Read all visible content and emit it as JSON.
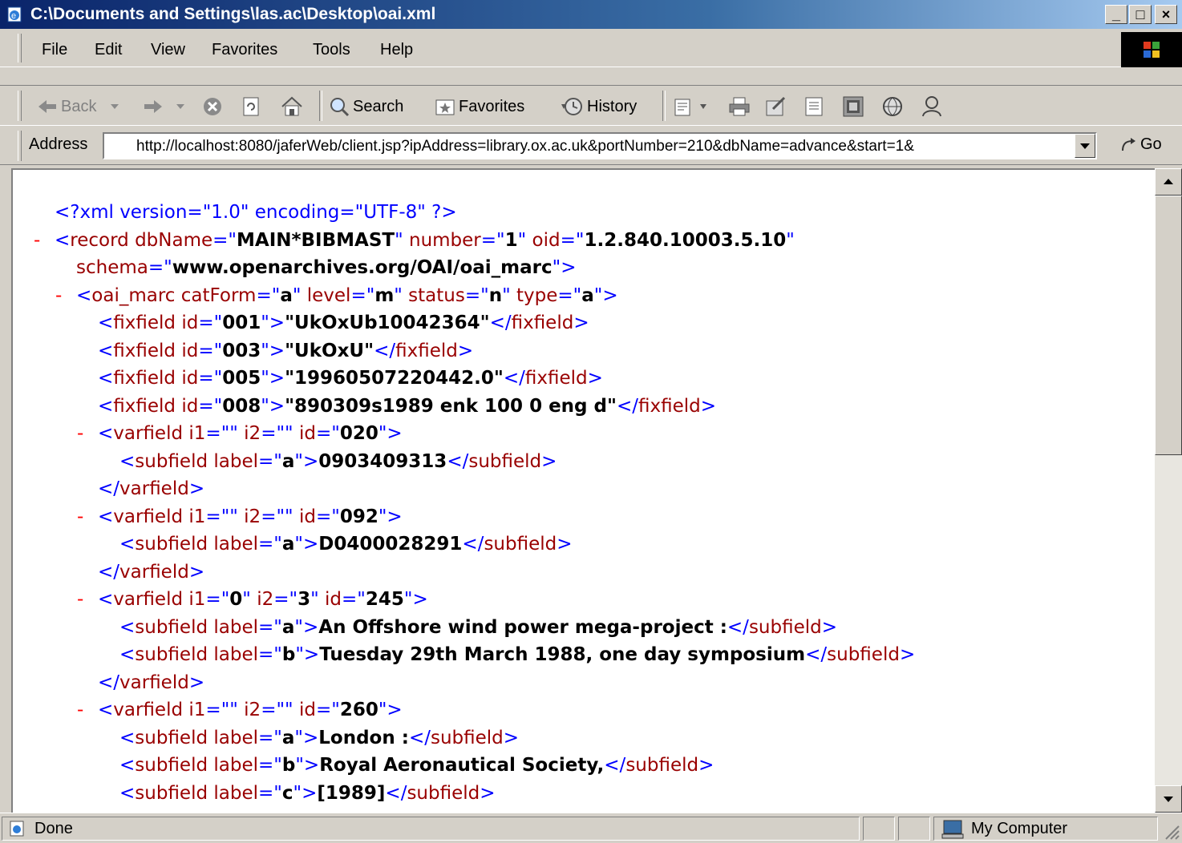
{
  "window": {
    "title": "C:\\Documents and Settings\\las.ac\\Desktop\\oai.xml",
    "min": "_",
    "max": "□",
    "close": "×"
  },
  "menu": {
    "items": [
      "File",
      "Edit",
      "View",
      "Favorites",
      "Tools",
      "Help"
    ]
  },
  "toolbar": {
    "back": "Back",
    "search": "Search",
    "favorites": "Favorites",
    "history": "History"
  },
  "address": {
    "label": "Address",
    "url": "http://localhost:8080/jaferWeb/client.jsp?ipAddress=library.ox.ac.uk&portNumber=210&dbName=advance&start=1&",
    "go": "Go"
  },
  "xml": {
    "lines": [
      {
        "indent": 0,
        "minus": false,
        "parts": [
          [
            "b",
            "<?xml version=\"1.0\" encoding=\"UTF-8\" ?>"
          ]
        ]
      },
      {
        "indent": 0,
        "minus": true,
        "parts": [
          [
            "b",
            "<"
          ],
          [
            "r",
            "record"
          ],
          [
            "r",
            " dbName"
          ],
          [
            "b",
            "=\""
          ],
          [
            "k",
            "MAIN*BIBMAST"
          ],
          [
            "b",
            "\""
          ],
          [
            "r",
            " number"
          ],
          [
            "b",
            "=\""
          ],
          [
            "k",
            "1"
          ],
          [
            "b",
            "\""
          ],
          [
            "r",
            " oid"
          ],
          [
            "b",
            "=\""
          ],
          [
            "k",
            "1.2.840.10003.5.10"
          ],
          [
            "b",
            "\""
          ]
        ]
      },
      {
        "indent": 1,
        "minus": false,
        "parts": [
          [
            "r",
            "schema"
          ],
          [
            "b",
            "=\""
          ],
          [
            "k",
            "www.openarchives.org/OAI/oai_marc"
          ],
          [
            "b",
            "\">"
          ]
        ]
      },
      {
        "indent": 1,
        "minus": true,
        "parts": [
          [
            "b",
            "<"
          ],
          [
            "r",
            "oai_marc"
          ],
          [
            "r",
            " catForm"
          ],
          [
            "b",
            "=\""
          ],
          [
            "k",
            "a"
          ],
          [
            "b",
            "\""
          ],
          [
            "r",
            " level"
          ],
          [
            "b",
            "=\""
          ],
          [
            "k",
            "m"
          ],
          [
            "b",
            "\""
          ],
          [
            "r",
            " status"
          ],
          [
            "b",
            "=\""
          ],
          [
            "k",
            "n"
          ],
          [
            "b",
            "\""
          ],
          [
            "r",
            " type"
          ],
          [
            "b",
            "=\""
          ],
          [
            "k",
            "a"
          ],
          [
            "b",
            "\">"
          ]
        ]
      },
      {
        "indent": 2,
        "minus": false,
        "parts": [
          [
            "b",
            "<"
          ],
          [
            "r",
            "fixfield"
          ],
          [
            "r",
            " id"
          ],
          [
            "b",
            "=\""
          ],
          [
            "k",
            "001"
          ],
          [
            "b",
            "\">"
          ],
          [
            "k",
            "\"UkOxUb10042364\""
          ],
          [
            "b",
            "</"
          ],
          [
            "r",
            "fixfield"
          ],
          [
            "b",
            ">"
          ]
        ]
      },
      {
        "indent": 2,
        "minus": false,
        "parts": [
          [
            "b",
            "<"
          ],
          [
            "r",
            "fixfield"
          ],
          [
            "r",
            " id"
          ],
          [
            "b",
            "=\""
          ],
          [
            "k",
            "003"
          ],
          [
            "b",
            "\">"
          ],
          [
            "k",
            "\"UkOxU\""
          ],
          [
            "b",
            "</"
          ],
          [
            "r",
            "fixfield"
          ],
          [
            "b",
            ">"
          ]
        ]
      },
      {
        "indent": 2,
        "minus": false,
        "parts": [
          [
            "b",
            "<"
          ],
          [
            "r",
            "fixfield"
          ],
          [
            "r",
            " id"
          ],
          [
            "b",
            "=\""
          ],
          [
            "k",
            "005"
          ],
          [
            "b",
            "\">"
          ],
          [
            "k",
            "\"19960507220442.0\""
          ],
          [
            "b",
            "</"
          ],
          [
            "r",
            "fixfield"
          ],
          [
            "b",
            ">"
          ]
        ]
      },
      {
        "indent": 2,
        "minus": false,
        "parts": [
          [
            "b",
            "<"
          ],
          [
            "r",
            "fixfield"
          ],
          [
            "r",
            " id"
          ],
          [
            "b",
            "=\""
          ],
          [
            "k",
            "008"
          ],
          [
            "b",
            "\">"
          ],
          [
            "k",
            "\"890309s1989 enk 100 0 eng d\""
          ],
          [
            "b",
            "</"
          ],
          [
            "r",
            "fixfield"
          ],
          [
            "b",
            ">"
          ]
        ]
      },
      {
        "indent": 2,
        "minus": true,
        "parts": [
          [
            "b",
            "<"
          ],
          [
            "r",
            "varfield"
          ],
          [
            "r",
            " i1"
          ],
          [
            "b",
            "=\"\""
          ],
          [
            "r",
            " i2"
          ],
          [
            "b",
            "=\"\""
          ],
          [
            "r",
            " id"
          ],
          [
            "b",
            "=\""
          ],
          [
            "k",
            "020"
          ],
          [
            "b",
            "\">"
          ]
        ]
      },
      {
        "indent": 3,
        "minus": false,
        "parts": [
          [
            "b",
            "<"
          ],
          [
            "r",
            "subfield"
          ],
          [
            "r",
            " label"
          ],
          [
            "b",
            "=\""
          ],
          [
            "k",
            "a"
          ],
          [
            "b",
            "\">"
          ],
          [
            "k",
            "0903409313"
          ],
          [
            "b",
            "</"
          ],
          [
            "r",
            "subfield"
          ],
          [
            "b",
            ">"
          ]
        ]
      },
      {
        "indent": 2,
        "minus": false,
        "parts": [
          [
            "b",
            "</"
          ],
          [
            "r",
            "varfield"
          ],
          [
            "b",
            ">"
          ]
        ]
      },
      {
        "indent": 2,
        "minus": true,
        "parts": [
          [
            "b",
            "<"
          ],
          [
            "r",
            "varfield"
          ],
          [
            "r",
            " i1"
          ],
          [
            "b",
            "=\"\""
          ],
          [
            "r",
            " i2"
          ],
          [
            "b",
            "=\"\""
          ],
          [
            "r",
            " id"
          ],
          [
            "b",
            "=\""
          ],
          [
            "k",
            "092"
          ],
          [
            "b",
            "\">"
          ]
        ]
      },
      {
        "indent": 3,
        "minus": false,
        "parts": [
          [
            "b",
            "<"
          ],
          [
            "r",
            "subfield"
          ],
          [
            "r",
            " label"
          ],
          [
            "b",
            "=\""
          ],
          [
            "k",
            "a"
          ],
          [
            "b",
            "\">"
          ],
          [
            "k",
            "D0400028291"
          ],
          [
            "b",
            "</"
          ],
          [
            "r",
            "subfield"
          ],
          [
            "b",
            ">"
          ]
        ]
      },
      {
        "indent": 2,
        "minus": false,
        "parts": [
          [
            "b",
            "</"
          ],
          [
            "r",
            "varfield"
          ],
          [
            "b",
            ">"
          ]
        ]
      },
      {
        "indent": 2,
        "minus": true,
        "parts": [
          [
            "b",
            "<"
          ],
          [
            "r",
            "varfield"
          ],
          [
            "r",
            " i1"
          ],
          [
            "b",
            "=\""
          ],
          [
            "k",
            "0"
          ],
          [
            "b",
            "\""
          ],
          [
            "r",
            " i2"
          ],
          [
            "b",
            "=\""
          ],
          [
            "k",
            "3"
          ],
          [
            "b",
            "\""
          ],
          [
            "r",
            " id"
          ],
          [
            "b",
            "=\""
          ],
          [
            "k",
            "245"
          ],
          [
            "b",
            "\">"
          ]
        ]
      },
      {
        "indent": 3,
        "minus": false,
        "parts": [
          [
            "b",
            "<"
          ],
          [
            "r",
            "subfield"
          ],
          [
            "r",
            " label"
          ],
          [
            "b",
            "=\""
          ],
          [
            "k",
            "a"
          ],
          [
            "b",
            "\">"
          ],
          [
            "k",
            "An Offshore wind power mega-project :"
          ],
          [
            "b",
            "</"
          ],
          [
            "r",
            "subfield"
          ],
          [
            "b",
            ">"
          ]
        ]
      },
      {
        "indent": 3,
        "minus": false,
        "parts": [
          [
            "b",
            "<"
          ],
          [
            "r",
            "subfield"
          ],
          [
            "r",
            " label"
          ],
          [
            "b",
            "=\""
          ],
          [
            "k",
            "b"
          ],
          [
            "b",
            "\">"
          ],
          [
            "k",
            "Tuesday 29th March 1988, one day symposium"
          ],
          [
            "b",
            "</"
          ],
          [
            "r",
            "subfield"
          ],
          [
            "b",
            ">"
          ]
        ]
      },
      {
        "indent": 2,
        "minus": false,
        "parts": [
          [
            "b",
            "</"
          ],
          [
            "r",
            "varfield"
          ],
          [
            "b",
            ">"
          ]
        ]
      },
      {
        "indent": 2,
        "minus": true,
        "parts": [
          [
            "b",
            "<"
          ],
          [
            "r",
            "varfield"
          ],
          [
            "r",
            " i1"
          ],
          [
            "b",
            "=\"\""
          ],
          [
            "r",
            " i2"
          ],
          [
            "b",
            "=\"\""
          ],
          [
            "r",
            " id"
          ],
          [
            "b",
            "=\""
          ],
          [
            "k",
            "260"
          ],
          [
            "b",
            "\">"
          ]
        ]
      },
      {
        "indent": 3,
        "minus": false,
        "parts": [
          [
            "b",
            "<"
          ],
          [
            "r",
            "subfield"
          ],
          [
            "r",
            " label"
          ],
          [
            "b",
            "=\""
          ],
          [
            "k",
            "a"
          ],
          [
            "b",
            "\">"
          ],
          [
            "k",
            "London :"
          ],
          [
            "b",
            "</"
          ],
          [
            "r",
            "subfield"
          ],
          [
            "b",
            ">"
          ]
        ]
      },
      {
        "indent": 3,
        "minus": false,
        "parts": [
          [
            "b",
            "<"
          ],
          [
            "r",
            "subfield"
          ],
          [
            "r",
            " label"
          ],
          [
            "b",
            "=\""
          ],
          [
            "k",
            "b"
          ],
          [
            "b",
            "\">"
          ],
          [
            "k",
            "Royal Aeronautical Society,"
          ],
          [
            "b",
            "</"
          ],
          [
            "r",
            "subfield"
          ],
          [
            "b",
            ">"
          ]
        ]
      },
      {
        "indent": 3,
        "minus": false,
        "parts": [
          [
            "b",
            "<"
          ],
          [
            "r",
            "subfield"
          ],
          [
            "r",
            " label"
          ],
          [
            "b",
            "=\""
          ],
          [
            "k",
            "c"
          ],
          [
            "b",
            "\">"
          ],
          [
            "k",
            "[1989]"
          ],
          [
            "b",
            "</"
          ],
          [
            "r",
            "subfield"
          ],
          [
            "b",
            ">"
          ]
        ]
      }
    ]
  },
  "status": {
    "text": "Done",
    "zone": "My Computer"
  }
}
